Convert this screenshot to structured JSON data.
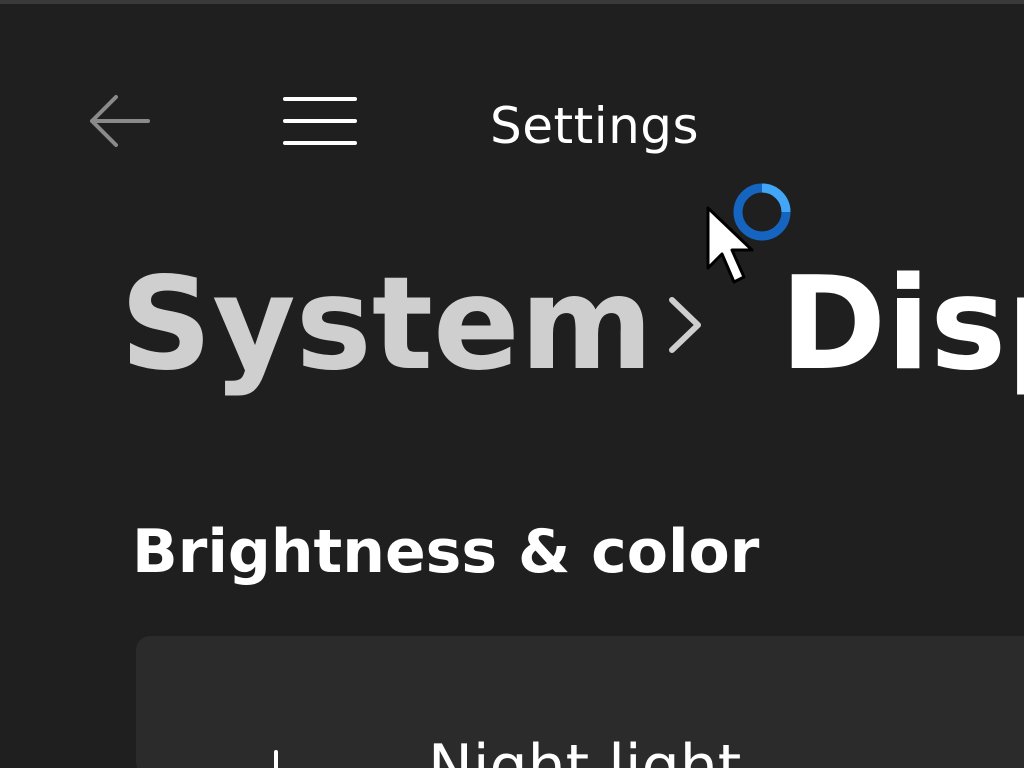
{
  "window": {
    "title": "Settings"
  },
  "titlebar": {
    "back_icon": "arrow-left-icon",
    "menu_icon": "hamburger-menu-icon"
  },
  "breadcrumb": {
    "parent": "System",
    "separator_icon": "chevron-right-icon",
    "current": "Disp"
  },
  "section": {
    "heading": "Brightness & color"
  },
  "cards": [
    {
      "label": "Night light",
      "icon": "night-light-icon"
    }
  ],
  "cursor": {
    "icon": "arrow-cursor-icon",
    "busy_icon": "busy-ring-icon"
  },
  "colors": {
    "background": "#1f1f1f",
    "card": "#2b2b2b",
    "breadcrumb_parent": "#cfcfcf",
    "text": "#ffffff",
    "accent": "#1e88e5"
  }
}
